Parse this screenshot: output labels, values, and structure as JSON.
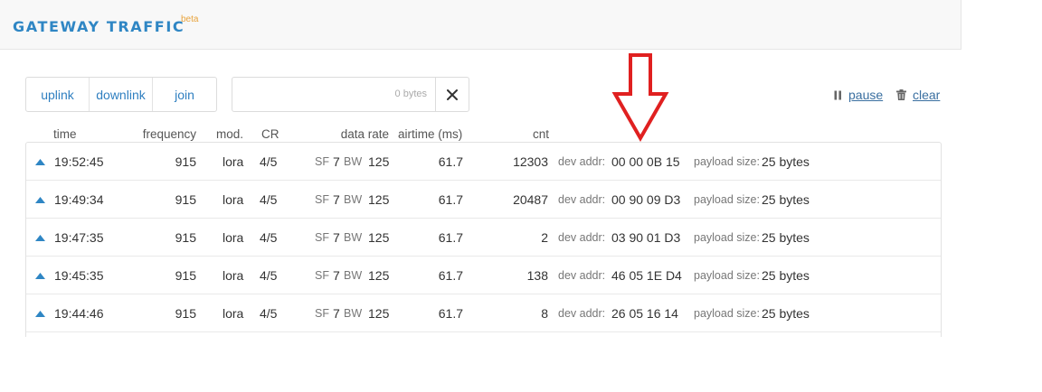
{
  "header": {
    "title": "GATEWAY TRAFFIC",
    "badge": "beta"
  },
  "toolbar": {
    "filters": [
      {
        "label": "uplink"
      },
      {
        "label": "downlink"
      },
      {
        "label": "join"
      }
    ],
    "search": {
      "value": "",
      "placeholder": "",
      "bytes_label": "0 bytes",
      "clear_icon": "close-icon"
    },
    "pause_label": "pause",
    "clear_label": "clear"
  },
  "table": {
    "columns": {
      "time": "time",
      "frequency": "frequency",
      "mod": "mod.",
      "cr": "CR",
      "data_rate": "data rate",
      "airtime": "airtime (ms)",
      "cnt": "cnt"
    },
    "rows": [
      {
        "direction": "uplink",
        "time": "19:52:45",
        "frequency": "915",
        "mod": "lora",
        "cr": "4/5",
        "sf_label": "SF",
        "sf": "7",
        "bw_label": "BW",
        "bw": "125",
        "airtime": "61.7",
        "cnt": "12303",
        "dev_addr_label": "dev addr:",
        "dev_addr": "00 00 0B 15",
        "payload_label": "payload size:",
        "payload": "25 bytes"
      },
      {
        "direction": "uplink",
        "time": "19:49:34",
        "frequency": "915",
        "mod": "lora",
        "cr": "4/5",
        "sf_label": "SF",
        "sf": "7",
        "bw_label": "BW",
        "bw": "125",
        "airtime": "61.7",
        "cnt": "20487",
        "dev_addr_label": "dev addr:",
        "dev_addr": "00 90 09 D3",
        "payload_label": "payload size:",
        "payload": "25 bytes"
      },
      {
        "direction": "uplink",
        "time": "19:47:35",
        "frequency": "915",
        "mod": "lora",
        "cr": "4/5",
        "sf_label": "SF",
        "sf": "7",
        "bw_label": "BW",
        "bw": "125",
        "airtime": "61.7",
        "cnt": "2",
        "dev_addr_label": "dev addr:",
        "dev_addr": "03 90 01 D3",
        "payload_label": "payload size:",
        "payload": "25 bytes"
      },
      {
        "direction": "uplink",
        "time": "19:45:35",
        "frequency": "915",
        "mod": "lora",
        "cr": "4/5",
        "sf_label": "SF",
        "sf": "7",
        "bw_label": "BW",
        "bw": "125",
        "airtime": "61.7",
        "cnt": "138",
        "dev_addr_label": "dev addr:",
        "dev_addr": "46 05 1E D4",
        "payload_label": "payload size:",
        "payload": "25 bytes"
      },
      {
        "direction": "uplink",
        "time": "19:44:46",
        "frequency": "915",
        "mod": "lora",
        "cr": "4/5",
        "sf_label": "SF",
        "sf": "7",
        "bw_label": "BW",
        "bw": "125",
        "airtime": "61.7",
        "cnt": "8",
        "dev_addr_label": "dev addr:",
        "dev_addr": "26 05 16 14",
        "payload_label": "payload size:",
        "payload": "25 bytes"
      }
    ]
  },
  "colors": {
    "accent": "#2f86c4",
    "link": "#2f7fc0",
    "badge": "#e8a33c",
    "annotation_arrow": "#e02020"
  },
  "icons": {
    "direction": "uplink-arrow-icon",
    "pause": "pause-icon",
    "clear": "trash-icon",
    "annotation": "down-arrow-annotation-icon"
  }
}
